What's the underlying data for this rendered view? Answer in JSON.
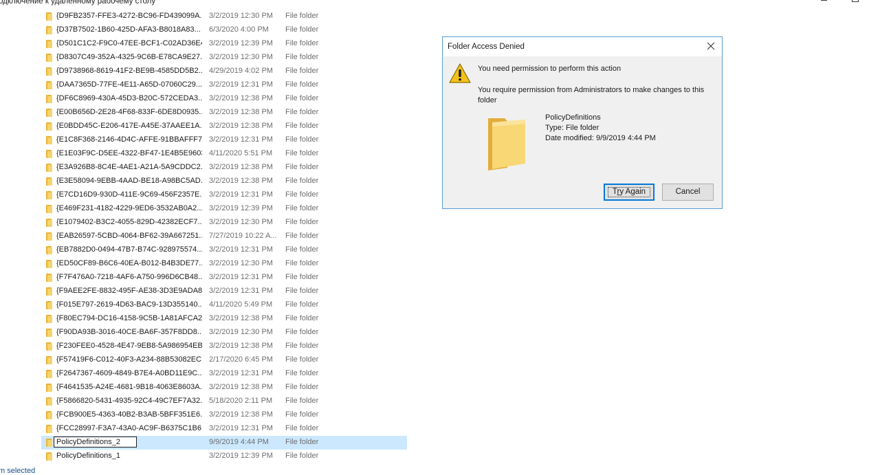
{
  "window": {
    "title": "одключение к удаленному рабочему столу"
  },
  "files": [
    {
      "name": "{D9FB2357-FFE3-4272-BC96-FD439099A...",
      "date": "3/2/2019 12:30 PM",
      "type": "File folder"
    },
    {
      "name": "{D37B7502-1B60-425D-AFA3-B8018A83...",
      "date": "6/3/2020 4:00 PM",
      "type": "File folder"
    },
    {
      "name": "{D501C1C2-F9C0-47EE-BCF1-C02AD36E4...",
      "date": "3/2/2019 12:39 PM",
      "type": "File folder"
    },
    {
      "name": "{D8307C49-352A-4325-9C6B-E78CA9E27...",
      "date": "3/2/2019 12:30 PM",
      "type": "File folder"
    },
    {
      "name": "{D9738968-8619-41F2-BE9B-4585DD5B2...",
      "date": "4/29/2019 4:02 PM",
      "type": "File folder"
    },
    {
      "name": "{DAA7365D-77FE-4E11-A65D-07060C29...",
      "date": "3/2/2019 12:31 PM",
      "type": "File folder"
    },
    {
      "name": "{DF6C8969-430A-45D3-B20C-572CEDA3...",
      "date": "3/2/2019 12:38 PM",
      "type": "File folder"
    },
    {
      "name": "{E00B656D-2E28-4F68-833F-6DE8D0935...",
      "date": "3/2/2019 12:38 PM",
      "type": "File folder"
    },
    {
      "name": "{E0BDD45C-E206-417E-A45E-37AAEE1A...",
      "date": "3/2/2019 12:38 PM",
      "type": "File folder"
    },
    {
      "name": "{E1C8F368-2146-4D4C-AFFE-91BBAFFF7...",
      "date": "3/2/2019 12:31 PM",
      "type": "File folder"
    },
    {
      "name": "{E1E03F9C-D5EE-4322-BF47-1E4B5E9603...",
      "date": "4/11/2020 5:51 PM",
      "type": "File folder"
    },
    {
      "name": "{E3A926B8-8C4E-4AE1-A21A-5A9CDDC2...",
      "date": "3/2/2019 12:38 PM",
      "type": "File folder"
    },
    {
      "name": "{E3E58094-9EBB-4AAD-BE18-A98BC5AD...",
      "date": "3/2/2019 12:38 PM",
      "type": "File folder"
    },
    {
      "name": "{E7CD16D9-930D-411E-9C69-456F2357E...",
      "date": "3/2/2019 12:31 PM",
      "type": "File folder"
    },
    {
      "name": "{E469F231-4182-4229-9ED6-3532AB0A2...",
      "date": "3/2/2019 12:39 PM",
      "type": "File folder"
    },
    {
      "name": "{E1079402-B3C2-4055-829D-42382ECF7...",
      "date": "3/2/2019 12:30 PM",
      "type": "File folder"
    },
    {
      "name": "{EAB26597-5CBD-4064-BF62-39A667251...",
      "date": "7/27/2019 10:22 A...",
      "type": "File folder"
    },
    {
      "name": "{EB7882D0-0494-47B7-B74C-928975574...",
      "date": "3/2/2019 12:31 PM",
      "type": "File folder"
    },
    {
      "name": "{ED50CF89-B6C6-40EA-B012-B4B3DE77...",
      "date": "3/2/2019 12:30 PM",
      "type": "File folder"
    },
    {
      "name": "{F7F476A0-7218-4AF6-A750-996D6CB48...",
      "date": "3/2/2019 12:31 PM",
      "type": "File folder"
    },
    {
      "name": "{F9AEE2FE-8832-495F-AE38-3D3E9ADA8...",
      "date": "3/2/2019 12:31 PM",
      "type": "File folder"
    },
    {
      "name": "{F015E797-2619-4D63-BAC9-13D355140...",
      "date": "4/11/2020 5:49 PM",
      "type": "File folder"
    },
    {
      "name": "{F80EC794-DC16-4158-9C5B-1A81AFCA2...",
      "date": "3/2/2019 12:38 PM",
      "type": "File folder"
    },
    {
      "name": "{F90DA93B-3016-40CE-BA6F-357F8DD8...",
      "date": "3/2/2019 12:30 PM",
      "type": "File folder"
    },
    {
      "name": "{F230FEE0-4528-4E47-9EB8-5A986954EB...",
      "date": "3/2/2019 12:38 PM",
      "type": "File folder"
    },
    {
      "name": "{F57419F6-C012-40F3-A234-88B53082EC...",
      "date": "2/17/2020 6:45 PM",
      "type": "File folder"
    },
    {
      "name": "{F2647367-4609-4849-B7E4-A0BD11E9C...",
      "date": "3/2/2019 12:31 PM",
      "type": "File folder"
    },
    {
      "name": "{F4641535-A24E-4681-9B18-4063E8603A...",
      "date": "3/2/2019 12:38 PM",
      "type": "File folder"
    },
    {
      "name": "{F5866820-5431-4935-92C4-49C7EF7A32...",
      "date": "5/18/2020 2:11 PM",
      "type": "File folder"
    },
    {
      "name": "{FCB900E5-4363-40B2-B3AB-5BFF351E6...",
      "date": "3/2/2019 12:38 PM",
      "type": "File folder"
    },
    {
      "name": "{FCC28997-F3A7-43A0-AC9F-B6375C1B6...",
      "date": "3/2/2019 12:31 PM",
      "type": "File folder"
    },
    {
      "name": "PolicyDefinitions_2",
      "date": "9/9/2019 4:44 PM",
      "type": "File folder",
      "selected": true,
      "editing": true
    },
    {
      "name": "PolicyDefinitions_1",
      "date": "3/2/2019 12:39 PM",
      "type": "File folder"
    }
  ],
  "status": {
    "text": "m selected"
  },
  "dialog": {
    "title": "Folder Access Denied",
    "message": "You need permission to perform this action",
    "detail": "You require permission from Administrators to make changes to this folder",
    "folder_name": "PolicyDefinitions",
    "folder_type": "Type: File folder",
    "folder_date": "Date modified: 9/9/2019 4:44 PM",
    "try_again_pre": "T",
    "try_again_u": "r",
    "try_again_post": "y Again",
    "cancel_label": "Cancel"
  },
  "icons": {
    "warning": "warning-icon",
    "folder": "folder-icon",
    "close": "close-icon"
  },
  "colors": {
    "selection": "#cce8ff",
    "dialog_border": "#5a9bd5",
    "focus_border": "#0078d7",
    "folder_yellow": "#f7d36b"
  }
}
